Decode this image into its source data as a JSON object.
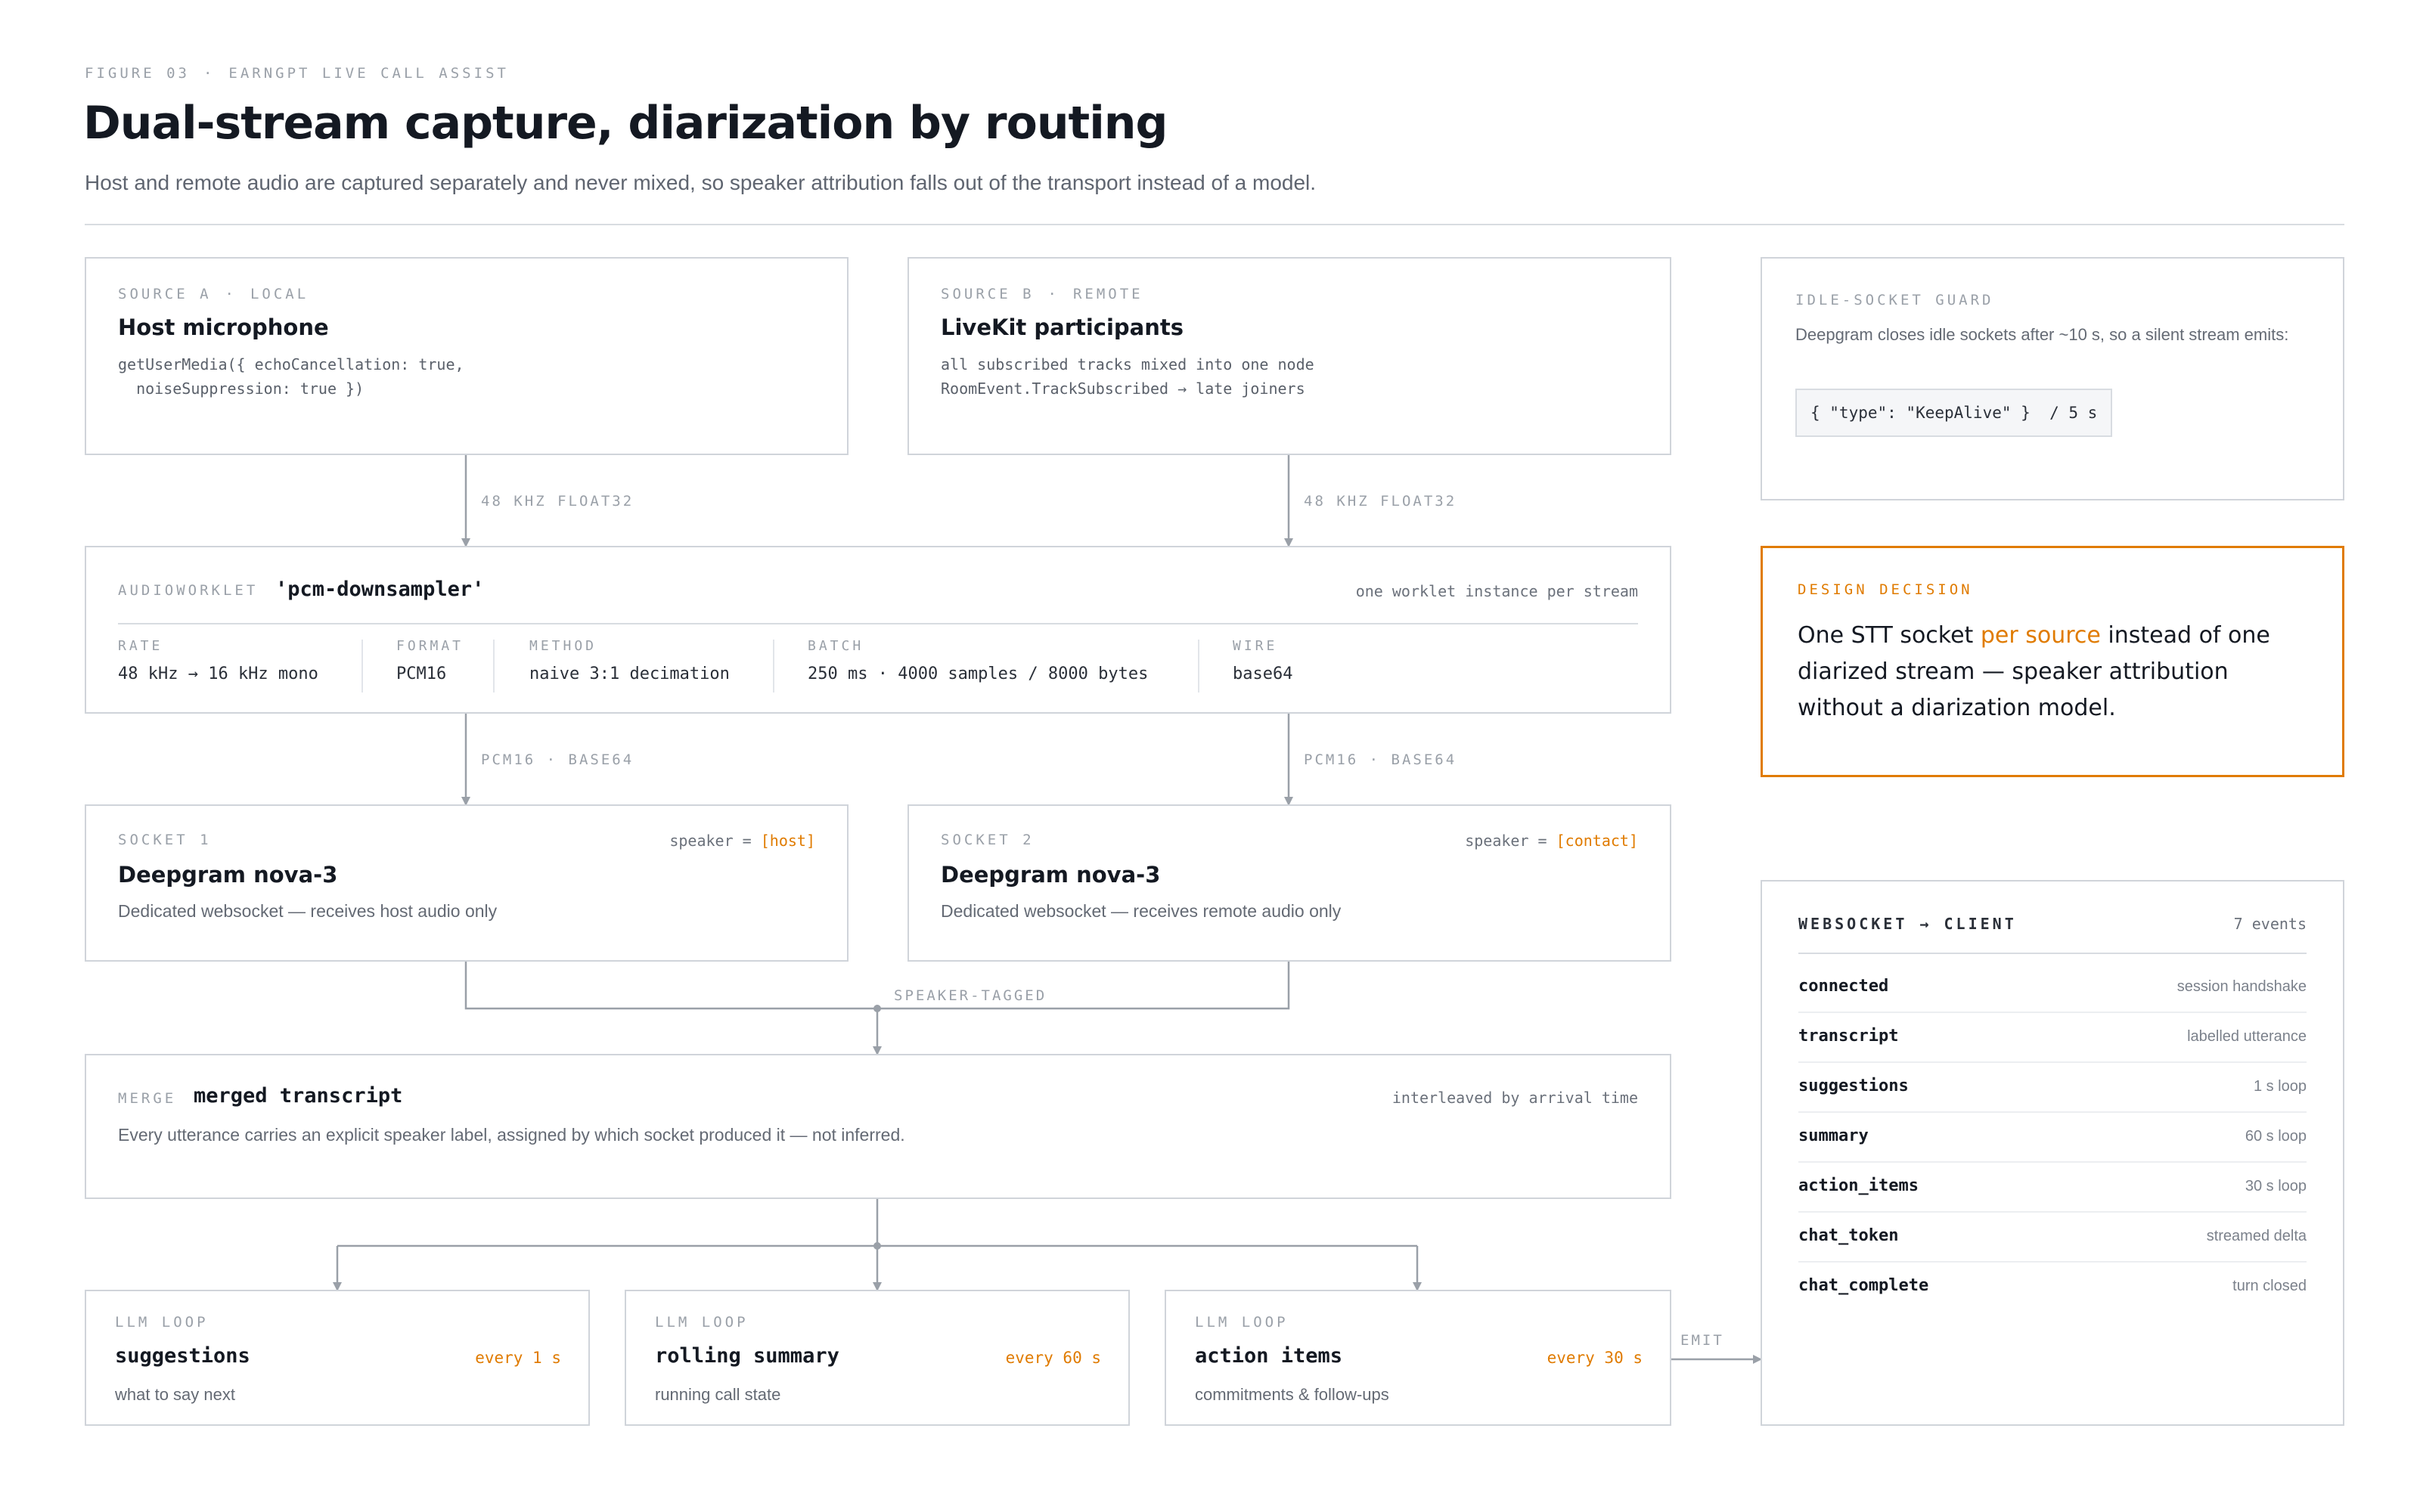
{
  "header": {
    "figure_label": "FIGURE 03",
    "figure_context": "EARNGPT LIVE CALL ASSIST",
    "title": "Dual-stream capture, diarization by routing",
    "subtitle": "Host and remote audio are captured separately and never mixed, so speaker attribution falls out of the transport instead of a model."
  },
  "source_a": {
    "tag": "SOURCE A",
    "kind": "LOCAL",
    "title": "Host microphone",
    "code": "getUserMedia({ echoCancellation: true,\n  noiseSuppression: true })"
  },
  "source_b": {
    "tag": "SOURCE B",
    "kind": "REMOTE",
    "title": "LiveKit participants",
    "code": "all subscribed tracks mixed into one node\nRoomEvent.TrackSubscribed → late joiners"
  },
  "flows": {
    "a_to_worklet": "48 KHZ FLOAT32",
    "b_to_worklet": "48 KHZ FLOAT32",
    "worklet_to_s1": "PCM16 · BASE64",
    "worklet_to_s2": "PCM16 · BASE64",
    "to_merge": "SPEAKER-TAGGED",
    "emit": "EMIT"
  },
  "worklet": {
    "tag": "AUDIOWORKLET",
    "name": "'pcm-downsampler'",
    "note": "one worklet instance per stream",
    "metrics": [
      {
        "label": "RATE",
        "value": "48 kHz → 16 kHz mono"
      },
      {
        "label": "FORMAT",
        "value": "PCM16"
      },
      {
        "label": "METHOD",
        "value": "naive 3:1 decimation"
      },
      {
        "label": "BATCH",
        "value": "250 ms · 4000 samples / 8000 bytes"
      },
      {
        "label": "WIRE",
        "value": "base64"
      }
    ]
  },
  "socket1": {
    "tag": "SOCKET 1",
    "speaker_prefix": "speaker = ",
    "speaker_value": "[host]",
    "title": "Deepgram nova-3",
    "desc": "Dedicated websocket — receives host audio only"
  },
  "socket2": {
    "tag": "SOCKET 2",
    "speaker_prefix": "speaker = ",
    "speaker_value": "[contact]",
    "title": "Deepgram nova-3",
    "desc": "Dedicated websocket — receives remote audio only"
  },
  "merge": {
    "tag": "MERGE",
    "title": "merged transcript",
    "note": "interleaved by arrival time",
    "desc": "Every utterance carries an explicit speaker label, assigned by which socket produced it — not inferred."
  },
  "llm_loops": [
    {
      "tag": "LLM LOOP",
      "title": "suggestions",
      "every": "every 1 s",
      "desc": "what to say next"
    },
    {
      "tag": "LLM LOOP",
      "title": "rolling summary",
      "every": "every 60 s",
      "desc": "running call state"
    },
    {
      "tag": "LLM LOOP",
      "title": "action items",
      "every": "every 30 s",
      "desc": "commitments & follow-ups"
    }
  ],
  "idle_guard": {
    "tag": "IDLE-SOCKET GUARD",
    "desc": "Deepgram closes idle sockets after ~10 s, so a silent stream emits:",
    "code": "{ \"type\": \"KeepAlive\" }  / 5 s"
  },
  "decision": {
    "tag": "DESIGN DECISION",
    "text_before": "One STT socket ",
    "text_highlight": "per source",
    "text_after": " instead of one diarized stream — speaker attribution without a diarization model."
  },
  "websocket": {
    "title": "WEBSOCKET → CLIENT",
    "count": "7 events",
    "events": [
      {
        "name": "connected",
        "desc": "session handshake"
      },
      {
        "name": "transcript",
        "desc": "labelled utterance"
      },
      {
        "name": "suggestions",
        "desc": "1 s loop"
      },
      {
        "name": "summary",
        "desc": "60 s loop"
      },
      {
        "name": "action_items",
        "desc": "30 s loop"
      },
      {
        "name": "chat_token",
        "desc": "streamed delta"
      },
      {
        "name": "chat_complete",
        "desc": "turn closed"
      }
    ]
  },
  "colors": {
    "accent": "#e07b00",
    "border": "#d0d4da",
    "connector": "#9aa0a8",
    "title": "#141922"
  }
}
